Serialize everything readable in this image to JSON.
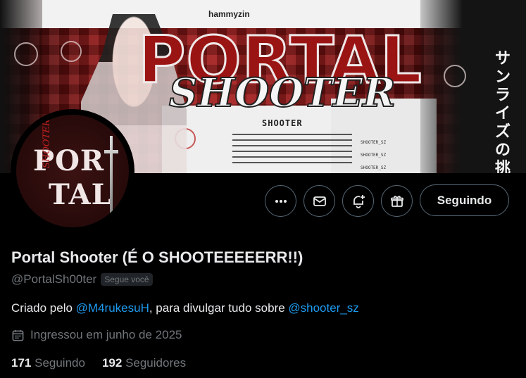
{
  "banner": {
    "brand": "hammyzin",
    "title": "PORTAL",
    "script_text": "SHOOTER",
    "heading": "SHOOTER",
    "socials": [
      "SHOOTER_SZ",
      "SHOOTER_SZ",
      "SHOOTER_SZ"
    ],
    "japanese": "サンライズの挑戦"
  },
  "avatar": {
    "line1": "POR",
    "line2": "TAL",
    "sub": "SHOOTER"
  },
  "actions": {
    "more_icon": "more-icon",
    "message_icon": "envelope-icon",
    "notify_icon": "bell-plus-icon",
    "gift_icon": "gift-icon",
    "follow_label": "Seguindo"
  },
  "profile": {
    "display_name": "Portal Shooter (É O SHOOTEEEEERR!!)",
    "handle": "@PortalSh00ter",
    "follows_you": "Segue você",
    "bio": {
      "part1": "Criado pelo ",
      "mention1": "@M4rukesuH",
      "part2": ", para divulgar tudo sobre ",
      "mention2": "@shooter_sz"
    },
    "joined": "Ingressou em junho de 2025",
    "following_count": "171",
    "following_label": "Seguindo",
    "followers_count": "192",
    "followers_label": "Seguidores"
  },
  "colors": {
    "accent": "#1d9bf0",
    "muted": "#71767b",
    "text": "#e7e9ea",
    "border": "#536471",
    "banner_red": "#9b1414"
  }
}
